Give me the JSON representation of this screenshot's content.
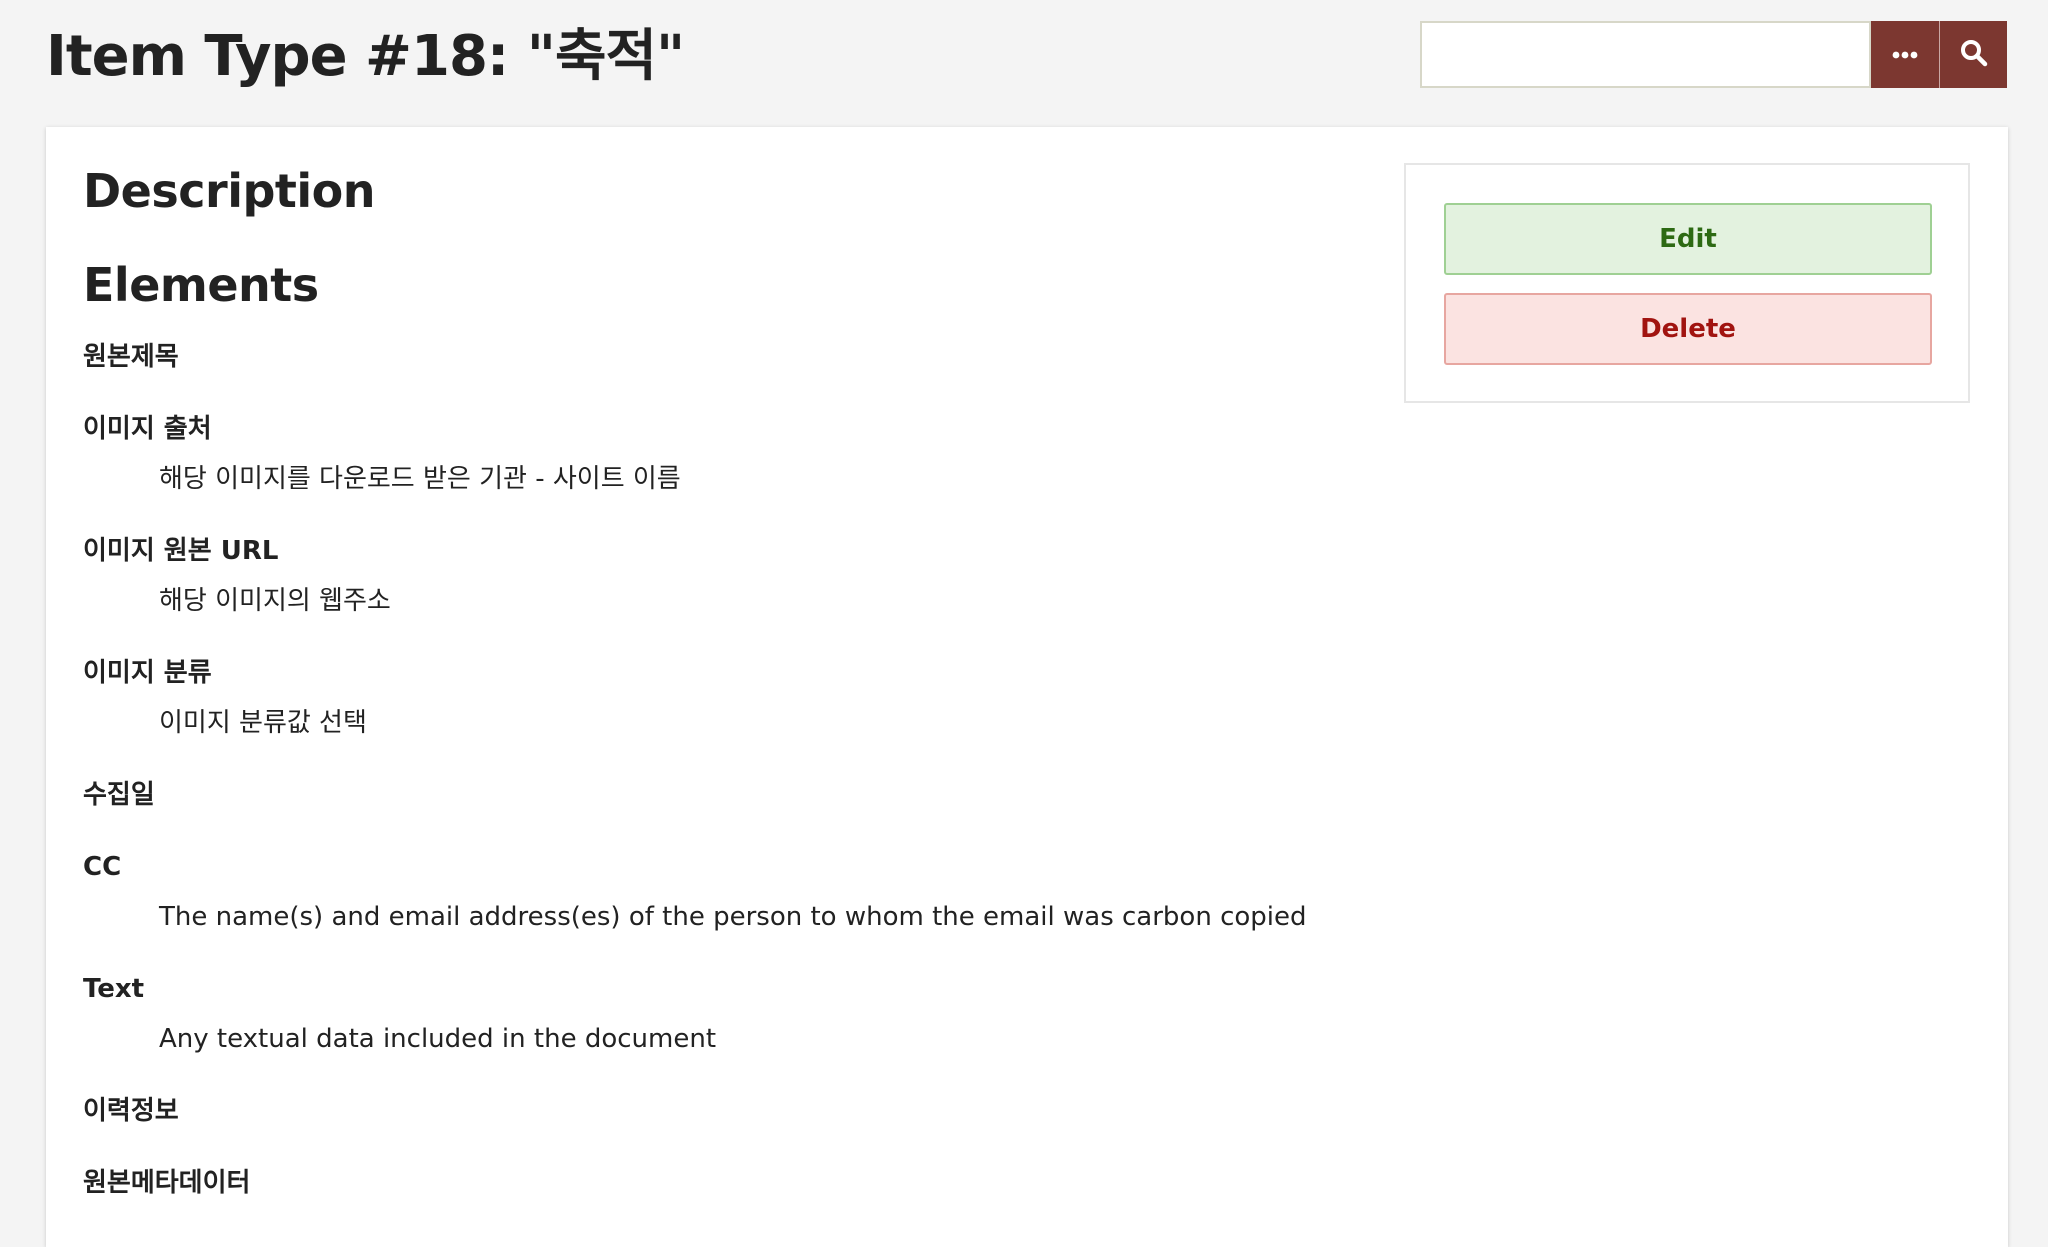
{
  "header": {
    "title": "Item Type #18: \"축적\"",
    "search_placeholder": "",
    "search_value": ""
  },
  "main": {
    "description_heading": "Description",
    "elements_heading": "Elements",
    "elements": [
      {
        "name": "원본제목",
        "description": ""
      },
      {
        "name": "이미지 출처",
        "description": "해당 이미지를 다운로드 받은 기관 - 사이트 이름"
      },
      {
        "name": "이미지 원본 URL",
        "description": "해당 이미지의 웹주소"
      },
      {
        "name": "이미지 분류",
        "description": "이미지 분류값 선택"
      },
      {
        "name": "수집일",
        "description": ""
      },
      {
        "name": "CC",
        "description": "The name(s) and email address(es) of the person to whom the email was carbon copied"
      },
      {
        "name": "Text",
        "description": "Any textual data included in the document"
      },
      {
        "name": "이력정보",
        "description": ""
      },
      {
        "name": "원본메타데이터",
        "description": ""
      }
    ]
  },
  "actions": {
    "edit_label": "Edit",
    "delete_label": "Delete"
  },
  "colors": {
    "accent": "#7c3730",
    "edit_text": "#2d6a13",
    "delete_text": "#a11410"
  },
  "icons": {
    "advanced_search": "ellipsis-icon",
    "submit_search": "search-icon"
  }
}
